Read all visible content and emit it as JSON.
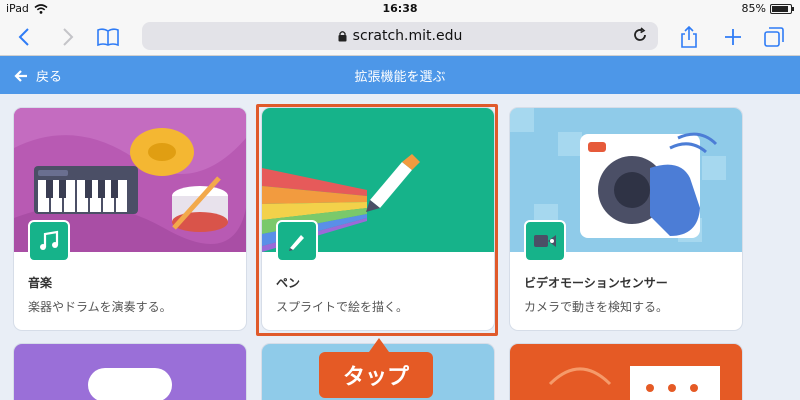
{
  "status_bar": {
    "device": "iPad",
    "time": "16:38",
    "battery": "85%",
    "battery_level": 0.85
  },
  "browser": {
    "url": "scratch.mit.edu"
  },
  "header": {
    "back_label": "戻る",
    "title": "拡張機能を選ぶ"
  },
  "extensions": [
    {
      "title": "音楽",
      "description": "楽器やドラムを演奏する。",
      "color": "#b85ab3"
    },
    {
      "title": "ペン",
      "description": "スプライトで絵を描く。",
      "color": "#16b38a"
    },
    {
      "title": "ビデオモーションセンサー",
      "description": "カメラで動きを検知する。",
      "color": "#8fcbe9"
    }
  ],
  "callout": {
    "label": "タップ"
  },
  "colors": {
    "accent": "#4d97e8",
    "highlight": "#e05a2b",
    "callout": "#e55a25"
  }
}
